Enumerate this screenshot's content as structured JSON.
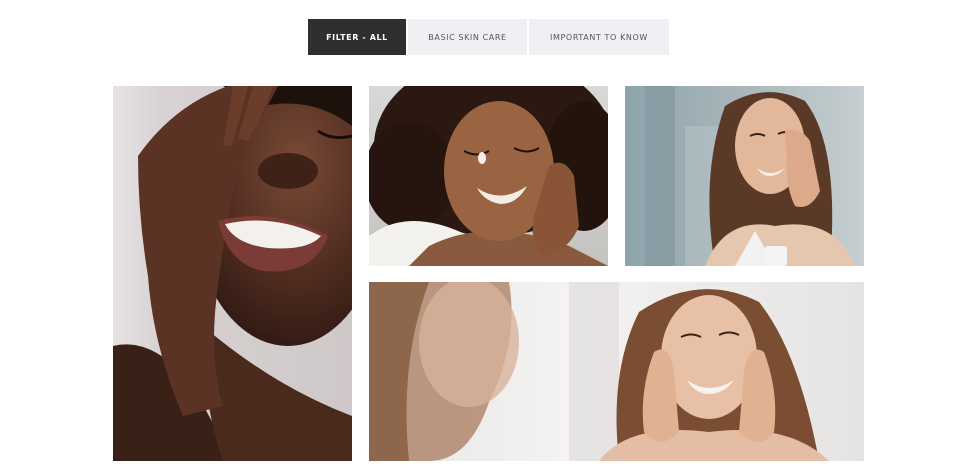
{
  "filters": [
    {
      "label": "FILTER - ALL",
      "active": true
    },
    {
      "label": "BASIC SKIN CARE",
      "active": false
    },
    {
      "label": "IMPORTANT TO KNOW",
      "active": false
    }
  ],
  "gallery": {
    "items": [
      {
        "subject": "woman laughing with hand over eye"
      },
      {
        "subject": "woman with curly hair applying cream to cheek"
      },
      {
        "subject": "woman applying cream in bathroom mirror"
      },
      {
        "subject": "woman smiling with hands on face, mirror reflection"
      }
    ]
  },
  "colors": {
    "active_bg": "#2f2f2f",
    "inactive_bg": "#eef0f3",
    "page_bg": "#ffffff"
  }
}
